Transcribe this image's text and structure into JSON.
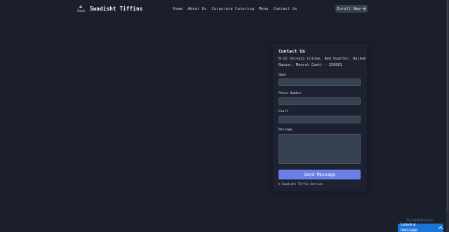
{
  "header": {
    "logo_alt": "Best",
    "brand": "Swadisht Tiffins",
    "nav": [
      "Home",
      "About Us",
      "Corporate Catering",
      "Menu",
      "Contact Us"
    ],
    "enroll_label": "Enroll Now",
    "enroll_icon": "arrow-right-icon"
  },
  "contact": {
    "title": "Contact Us",
    "address": "B-15 Shivaji Colony, Red Quarter, Rajban Bazaar, Meerut Cantt - 250001",
    "fields": {
      "name_label": "Name",
      "name_value": "",
      "phone_label": "Phone Number",
      "phone_value": "",
      "email_label": "Email",
      "email_value": "",
      "message_label": "Message",
      "message_value": ""
    },
    "send_label": "Send Message",
    "copyright": "© Swadisht Tiffin Service"
  },
  "watermark": "ScanMalware",
  "chat": {
    "label": "Leave a message",
    "icon": "chevron-up-icon"
  },
  "colors": {
    "background": "#1b1f2b",
    "card": "#1e2230",
    "input": "#374151",
    "accent": "#6b7fe6",
    "chat": "#1a73d9"
  }
}
